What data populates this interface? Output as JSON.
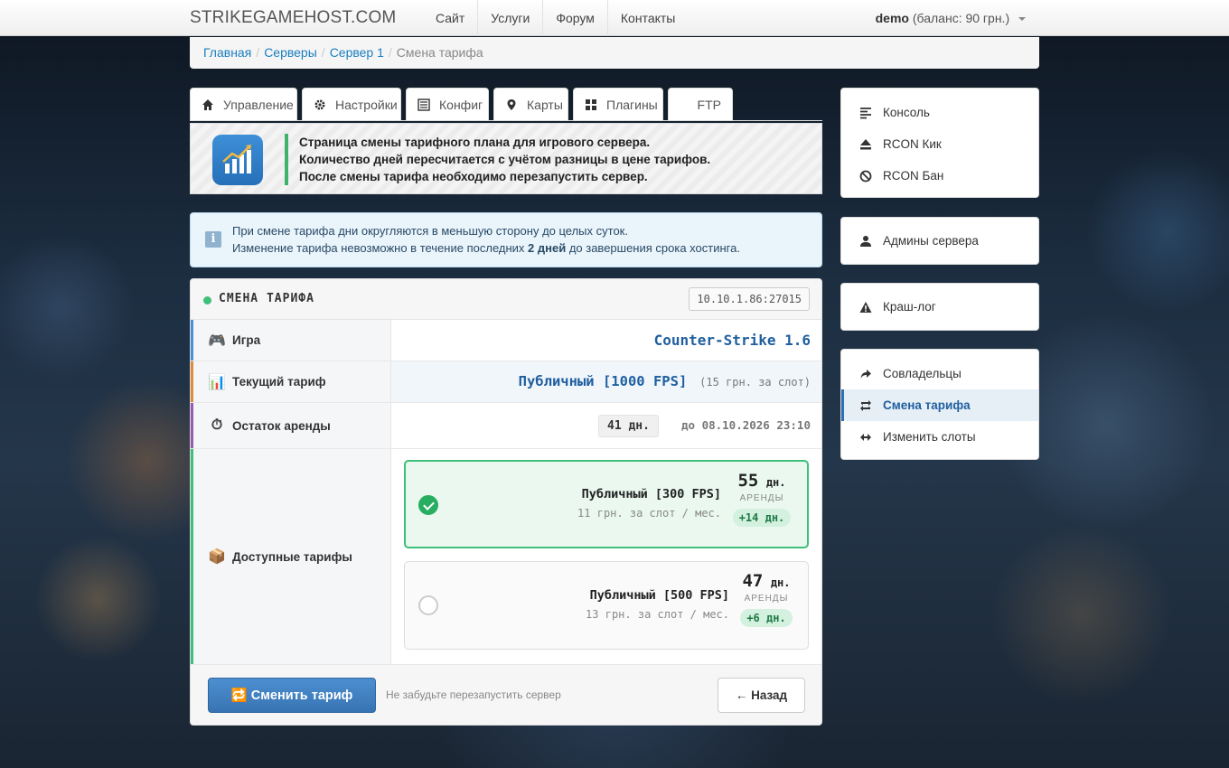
{
  "navbar": {
    "brand": "STRIKEGAMEHOST.COM",
    "links": [
      "Сайт",
      "Услуги",
      "Форум",
      "Контакты"
    ],
    "user_name": "demo",
    "balance": "(баланс: 90 грн.)"
  },
  "breadcrumb": {
    "items": [
      "Главная",
      "Серверы",
      "Сервер 1"
    ],
    "active": "Смена тарифа"
  },
  "tabs": [
    {
      "label": "Управление",
      "icon": "home-icon"
    },
    {
      "label": "Настройки",
      "icon": "gear-icon"
    },
    {
      "label": "Конфиг",
      "icon": "list-icon"
    },
    {
      "label": "Карты",
      "icon": "map-marker-icon"
    },
    {
      "label": "Плагины",
      "icon": "grid-icon"
    },
    {
      "label": "FTP",
      "icon": "ftp-icon"
    }
  ],
  "intro": {
    "lines": [
      "Страница смены тарифного плана для игрового сервера.",
      "Количество дней пересчитается с учётом разницы в цене тарифов.",
      "После смены тарифа необходимо перезапустить сервер."
    ]
  },
  "info": {
    "line1": "При смене тарифа дни округляются в меньшую сторону до целых суток.",
    "line2_pre": "Изменение тарифа невозможно в течение последних ",
    "line2_bold": "2 дней",
    "line2_post": " до завершения срока хостинга."
  },
  "panel": {
    "title": "СМЕНА ТАРИФА",
    "ip": "10.10.1.86:27015",
    "game_label": "Игра",
    "game_value": "Counter-Strike 1.6",
    "current_label": "Текущий тариф",
    "current_value": "Публичный [1000 FPS]",
    "current_price": "(15 грн. за слот)",
    "remaining_label": "Остаток аренды",
    "remaining_days": "41 дн.",
    "remaining_until": "до 08.10.2026 23:10",
    "available_label": "Доступные тарифы",
    "tariffs": [
      {
        "name": "Публичный [300 FPS]",
        "price": "11 грн. за слот / мес.",
        "days": "55",
        "days_unit": "дн.",
        "days_caption": "АРЕНДЫ",
        "delta": "+14 дн.",
        "selected": true
      },
      {
        "name": "Публичный [500 FPS]",
        "price": "13 грн. за слот / мес.",
        "days": "47",
        "days_unit": "дн.",
        "days_caption": "АРЕНДЫ",
        "delta": "+6 дн.",
        "selected": false
      }
    ],
    "submit_label": "🔁 Сменить тариф",
    "hint": "Не забудьте перезапустить сервер",
    "back_label": "← Назад"
  },
  "sidebar": {
    "group1": [
      {
        "label": "Консоль",
        "icon": "console-icon"
      },
      {
        "label": "RCON Кик",
        "icon": "eject-icon"
      },
      {
        "label": "RCON Бан",
        "icon": "ban-icon"
      }
    ],
    "group2": [
      {
        "label": "Админы сервера",
        "icon": "user-icon"
      }
    ],
    "group3": [
      {
        "label": "Краш-лог",
        "icon": "warning-icon"
      }
    ],
    "group4": [
      {
        "label": "Совладельцы",
        "icon": "share-icon",
        "active": false
      },
      {
        "label": "Смена тарифа",
        "icon": "retweet-icon",
        "active": true
      },
      {
        "label": "Изменить слоты",
        "icon": "resize-icon",
        "active": false
      }
    ]
  },
  "colors": {
    "accent": "#1a7fbf",
    "success": "#3fbf7a",
    "primary_button": "#3874b3"
  }
}
